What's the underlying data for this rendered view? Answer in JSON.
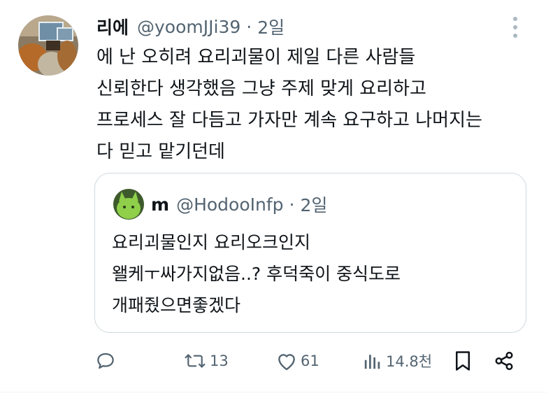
{
  "tweet": {
    "display_name": "리에",
    "handle": "@yoomJJi39",
    "separator": "·",
    "time": "2일",
    "lines": [
      "에 난 오히려 요리괴물이 제일 다른 사람들",
      "신뢰한다 생각했음 그냥 주제 맞게 요리하고",
      "프로세스 잘 다듬고 가자만 계속 요구하고 나머지는",
      "다 믿고 맡기던데"
    ]
  },
  "quote": {
    "display_name": "m",
    "handle": "@HodooInfp",
    "separator": "·",
    "time": "2일",
    "lines": [
      "요리괴물인지 요리오크인지",
      "왤케ㅜ싸가지없음..?  후덕죽이 중식도로",
      "개패줬으면좋겠다"
    ]
  },
  "actions": {
    "reply_count": "",
    "retweet_count": "13",
    "like_count": "61",
    "view_count": "14.8천"
  },
  "colors": {
    "text": "#0f1419",
    "secondary": "#536471",
    "border": "#cfd9de"
  },
  "icons": [
    "more-icon",
    "reply-icon",
    "retweet-icon",
    "like-icon",
    "views-icon",
    "bookmark-icon",
    "share-icon"
  ]
}
